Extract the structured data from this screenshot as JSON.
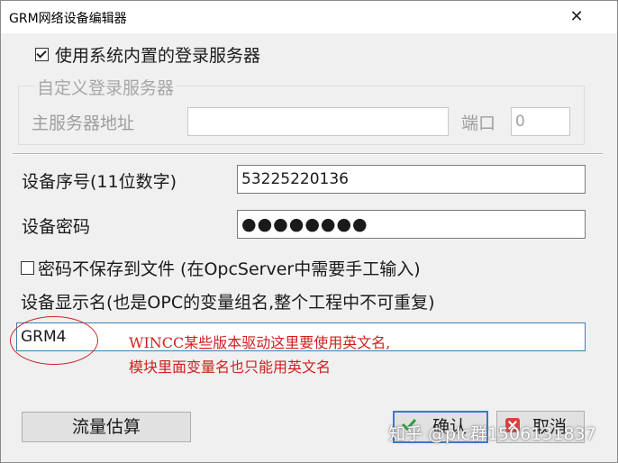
{
  "window": {
    "title": "GRM网络设备编辑器",
    "close_glyph": "✕"
  },
  "use_builtin_login": {
    "label": "使用系统内置的登录服务器",
    "checked": true
  },
  "custom_login_group": {
    "legend": "自定义登录服务器",
    "server_address_label": "主服务器地址",
    "server_address_value": "",
    "port_label": "端口",
    "port_value": "0"
  },
  "device_serial": {
    "label": "设备序号(11位数字)",
    "value": "53225220136"
  },
  "device_password": {
    "label": "设备密码",
    "masked_value": "●●●●●●●●"
  },
  "no_save_password": {
    "label": "密码不保存到文件 (在OpcServer中需要手工输入)",
    "checked": false
  },
  "display_name": {
    "label": "设备显示名(也是OPC的变量组名,整个工程中不可重复)",
    "value": "GRM4"
  },
  "annotation": {
    "line1": "WINCC某些版本驱动这里要使用英文名,",
    "line2": "模块里面变量名也只能用英文名",
    "color": "#d02020"
  },
  "buttons": {
    "traffic_estimate": "流量估算",
    "ok": "确认",
    "cancel": "取消"
  },
  "watermark": "知乎 @plc群1506131837",
  "colors": {
    "dialog_bg": "#f0f0f0",
    "focus_border": "#3c7fb1",
    "annotation_ellipse": "#c8282d"
  }
}
